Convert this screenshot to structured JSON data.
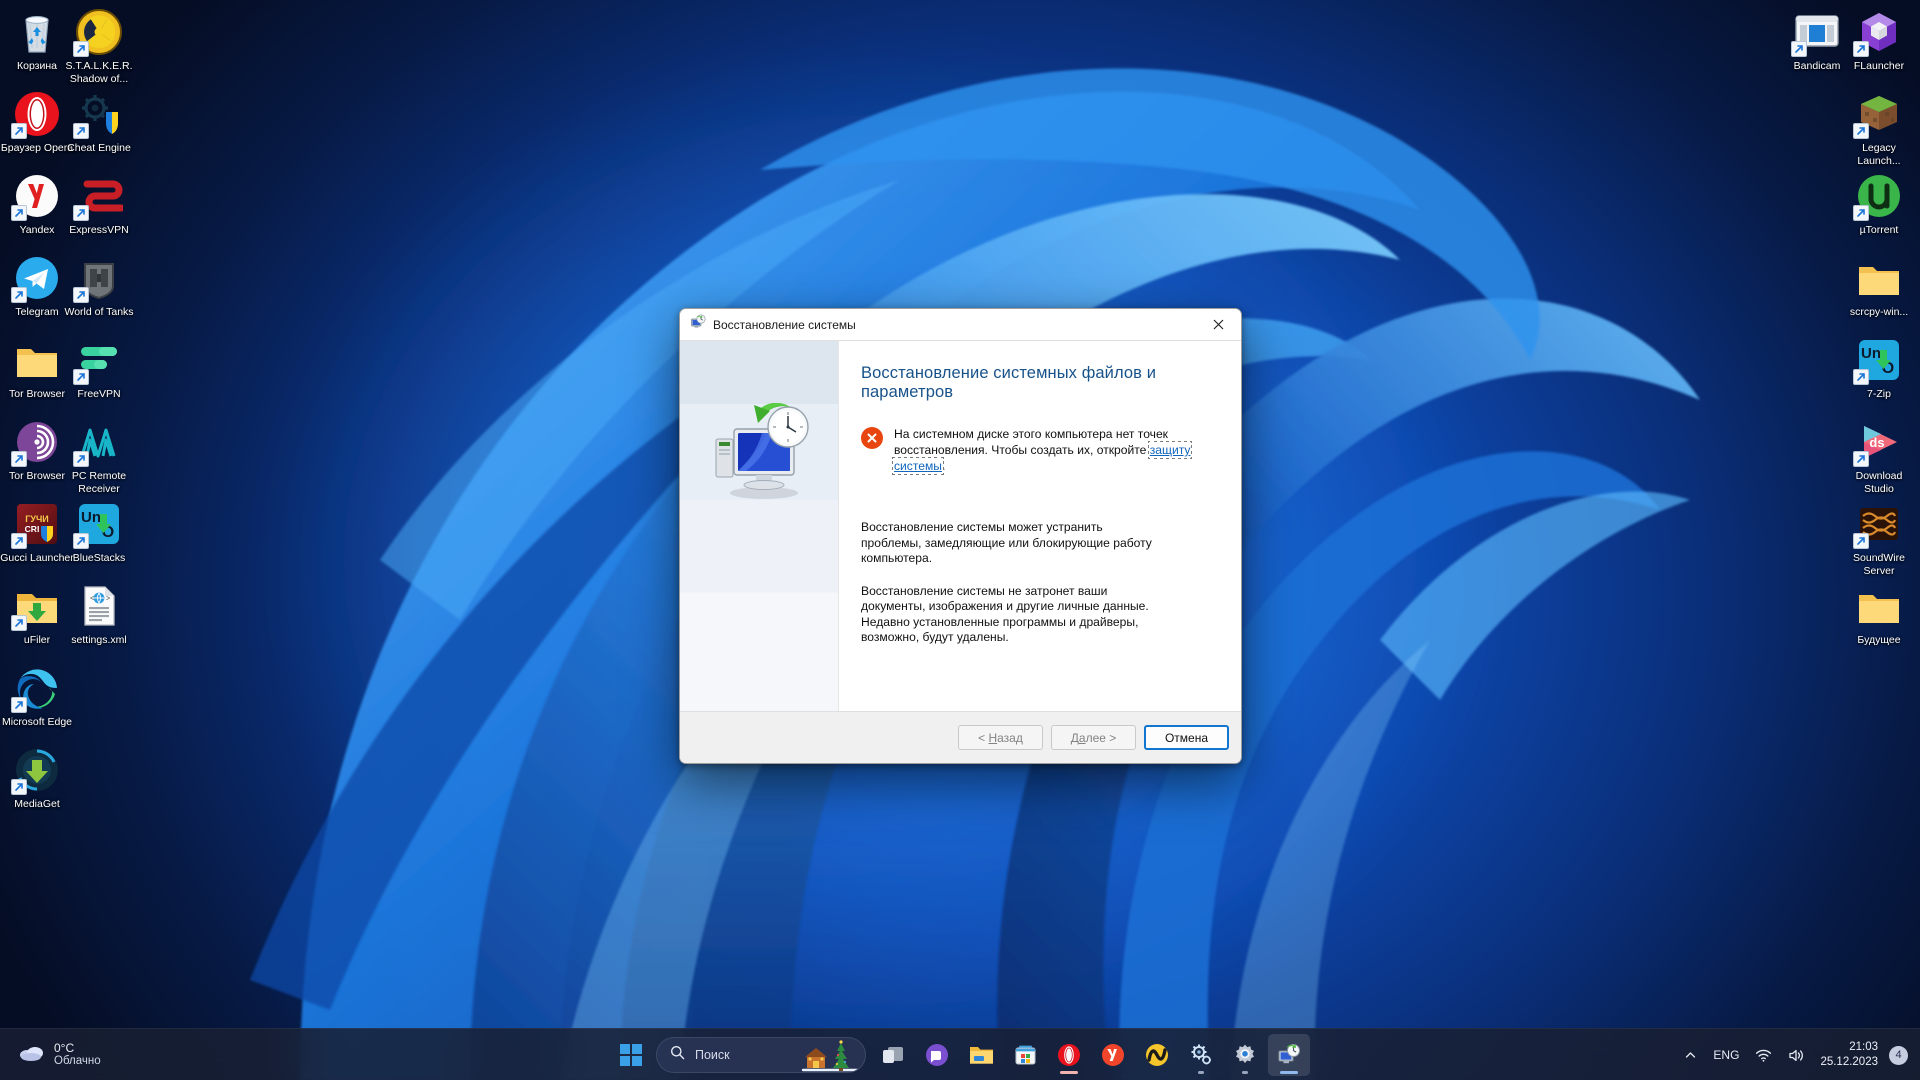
{
  "desktop": {
    "icons_left": [
      {
        "label": "Корзина",
        "icon": "recycle-bin-icon",
        "shortcut": false
      },
      {
        "label": "S.T.A.L.K.E.R. Shadow of...",
        "icon": "stalker-radiation-icon",
        "shortcut": true
      },
      {
        "label": "Браузер Opera",
        "icon": "opera-browser-icon",
        "shortcut": true
      },
      {
        "label": "Cheat Engine",
        "icon": "cheat-engine-icon",
        "shortcut": true
      },
      {
        "label": "Yandex",
        "icon": "yandex-browser-icon",
        "shortcut": true
      },
      {
        "label": "ExpressVPN",
        "icon": "expressvpn-icon",
        "shortcut": true
      },
      {
        "label": "Telegram",
        "icon": "telegram-icon",
        "shortcut": true
      },
      {
        "label": "World of Tanks",
        "icon": "world-of-tanks-icon",
        "shortcut": true
      },
      {
        "label": "Tor Browser",
        "icon": "folder-icon",
        "shortcut": false
      },
      {
        "label": "FreeVPN",
        "icon": "freevpn-icon",
        "shortcut": true
      },
      {
        "label": "Tor Browser",
        "icon": "tor-onion-icon",
        "shortcut": true
      },
      {
        "label": "PC Remote Receiver",
        "icon": "pc-remote-receiver-icon",
        "shortcut": true
      },
      {
        "label": "Gucci Launcher",
        "icon": "gucci-launcher-icon",
        "shortcut": true
      },
      {
        "label": "BlueStacks",
        "icon": "bluestacks-icon",
        "shortcut": true
      },
      {
        "label": "uFiler",
        "icon": "download-folder-icon",
        "shortcut": true
      },
      {
        "label": "settings.xml",
        "icon": "xml-file-icon",
        "shortcut": false
      },
      {
        "label": "Microsoft Edge",
        "icon": "microsoft-edge-icon",
        "shortcut": true
      },
      {
        "label": "MediaGet",
        "icon": "mediaget-icon",
        "shortcut": true
      }
    ],
    "icons_right": [
      {
        "label": "Bandicam",
        "icon": "bandicam-icon",
        "shortcut": true
      },
      {
        "label": "FLauncher",
        "icon": "flauncher-icon",
        "shortcut": true
      },
      {
        "label": "Legacy Launch...",
        "icon": "minecraft-grass-block-icon",
        "shortcut": true
      },
      {
        "label": "µTorrent",
        "icon": "utorrent-icon",
        "shortcut": true
      },
      {
        "label": "scrcpy-win...",
        "icon": "folder-icon",
        "shortcut": false
      },
      {
        "label": "7-Zip",
        "icon": "7zip-uno-icon",
        "shortcut": true
      },
      {
        "label": "Download Studio",
        "icon": "download-studio-icon",
        "shortcut": true
      },
      {
        "label": "SoundWire Server",
        "icon": "soundwire-server-icon",
        "shortcut": true
      },
      {
        "label": "Будущее",
        "icon": "folder-icon",
        "shortcut": false
      }
    ]
  },
  "taskbar": {
    "weather": {
      "temperature": "0°C",
      "condition": "Облачно",
      "icon": "cloud-icon"
    },
    "start_button": {
      "name": "start-button",
      "icon": "windows-logo-icon"
    },
    "search": {
      "placeholder": "Поиск",
      "icon": "search-icon",
      "decoration": "christmas-tree-house-icon"
    },
    "apps": [
      {
        "name": "task-view",
        "icon": "task-view-icon",
        "state": "none"
      },
      {
        "name": "discord",
        "icon": "discord-icon",
        "state": "none"
      },
      {
        "name": "file-explorer",
        "icon": "file-explorer-icon",
        "state": "none"
      },
      {
        "name": "microsoft-store",
        "icon": "microsoft-store-icon",
        "state": "none"
      },
      {
        "name": "opera",
        "icon": "opera-icon",
        "state": "active"
      },
      {
        "name": "yandex",
        "icon": "yandex-icon",
        "state": "none"
      },
      {
        "name": "mediaget",
        "icon": "mediaget-taskbar-icon",
        "state": "none"
      },
      {
        "name": "cheat-engine",
        "icon": "cheat-engine-icon",
        "state": "minimized"
      },
      {
        "name": "settings",
        "icon": "settings-gear-icon",
        "state": "minimized"
      },
      {
        "name": "system-restore",
        "icon": "system-restore-icon",
        "state": "focused"
      }
    ],
    "tray": {
      "overflow_icon": "chevron-up-icon",
      "language": "ENG",
      "network_icon": "wifi-icon",
      "volume_icon": "speaker-icon",
      "time": "21:03",
      "date": "25.12.2023",
      "notification_count": "4"
    }
  },
  "dialog": {
    "title": "Восстановление системы",
    "title_icon": "system-restore-icon",
    "close_icon": "close-icon",
    "illustration": "monitor-clock-restore-icon",
    "heading": "Восстановление системных файлов и параметров",
    "error": {
      "icon": "error-icon",
      "text_before": "На системном диске этого компьютера нет точек восстановления. Чтобы создать их, откройте ",
      "link_text": "защиту системы",
      "text_after": "."
    },
    "paragraphs": [
      "Восстановление системы может устранить проблемы, замедляющие или блокирующие работу компьютера.",
      "Восстановление системы не затронет ваши документы, изображения и другие личные данные. Недавно установленные программы и драйверы, возможно, будут удалены."
    ],
    "buttons": {
      "back": {
        "label_prefix": "< ",
        "label_accel": "Н",
        "label_rest": "азад",
        "enabled": false
      },
      "next": {
        "label_prefix": "Д",
        "label_accel": "а",
        "label_rest": "лее >",
        "enabled": false
      },
      "cancel": {
        "label": "Отмена",
        "enabled": true,
        "default": true
      }
    }
  },
  "colors": {
    "accent": "#1176d0",
    "error": "#e8450f",
    "link": "#1065bd",
    "heading": "#18528a",
    "taskbar_bg": "#181f33"
  }
}
